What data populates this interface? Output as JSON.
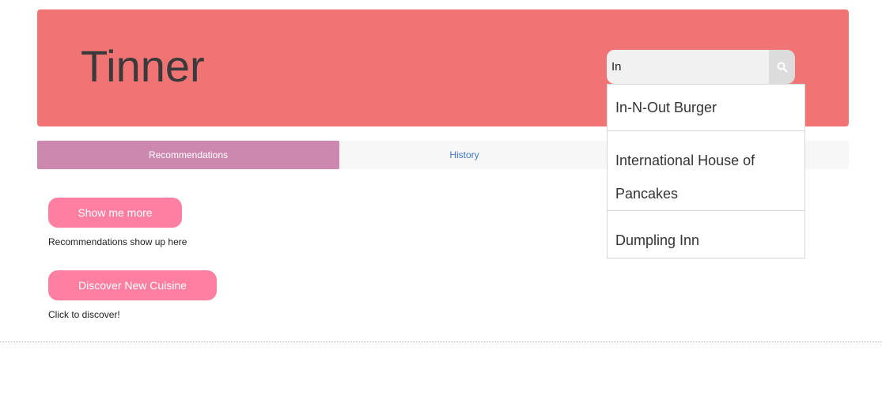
{
  "header": {
    "brand": "Tinner",
    "background_color": "#f07474"
  },
  "search": {
    "value": "In",
    "icon": "search-icon"
  },
  "suggestions": [
    {
      "label": "In-N-Out Burger"
    },
    {
      "label": "International House of Pancakes"
    },
    {
      "label": "Dumpling Inn"
    }
  ],
  "tabs": [
    {
      "label": "Recommendations",
      "active": true
    },
    {
      "label": "History",
      "active": false
    }
  ],
  "actions": {
    "show_more_label": "Show me more",
    "show_more_caption": "Recommendations show up here",
    "discover_label": "Discover New Cuisine",
    "discover_caption": "Click to discover!"
  },
  "colors": {
    "accent_tab": "#cd88b0",
    "button": "#ff7fa2",
    "link": "#3d77c4"
  }
}
